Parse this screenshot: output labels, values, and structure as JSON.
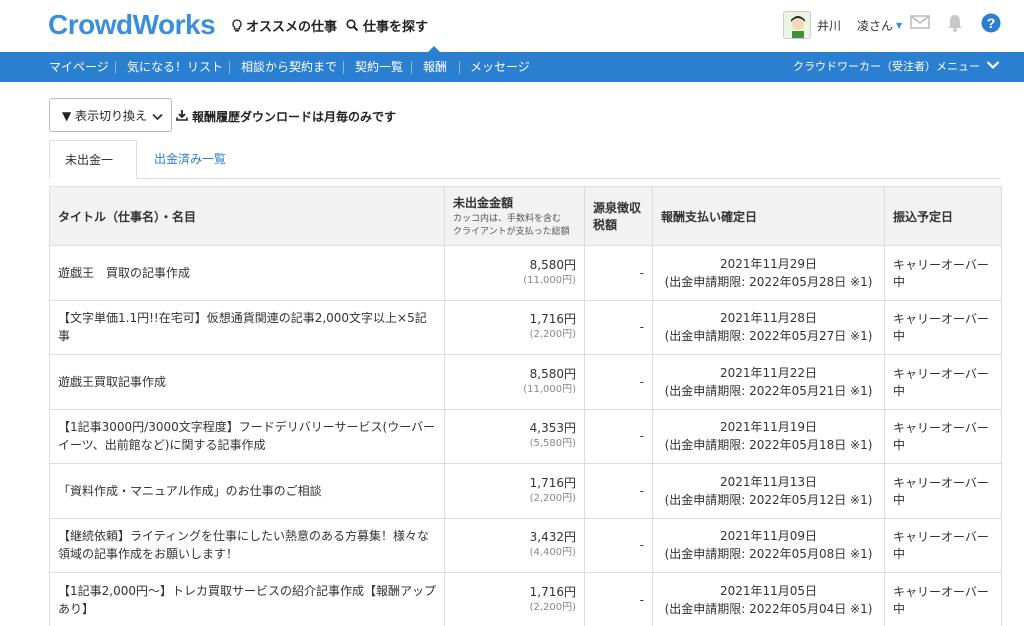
{
  "header": {
    "logo": "CrowdWorks",
    "recommend_jobs": "オススメの仕事",
    "find_jobs": "仕事を探す",
    "user_last": "井川",
    "user_first": "凌さん"
  },
  "nav": {
    "items": [
      "マイページ",
      "気になる！リスト",
      "相談から契約まで",
      "契約一覧",
      "報酬",
      "メッセージ"
    ],
    "active": "報酬",
    "right_menu": "クラウドワーカー（受注者）メニュー"
  },
  "controls": {
    "view_toggle": "▼ 表示切り換え",
    "download_note": "報酬履歴ダウンロードは月毎のみです"
  },
  "tabs": {
    "unpaid": "未出金一覧",
    "paid": "出金済み一覧"
  },
  "table": {
    "headers": {
      "title": "タイトル（仕事名）・名目",
      "amount": "未出金金額",
      "amount_note1": "カッコ内は、手数料を含む",
      "amount_note2": "クライアントが支払った総額",
      "tax1": "源泉徴収",
      "tax2": "税額",
      "confirm_date": "報酬支払い確定日",
      "transfer": "振込予定日"
    },
    "rows": [
      {
        "title": "遊戯王　買取の記事作成",
        "amount": "8,580円",
        "total": "(11,000円)",
        "tax": "-",
        "date": "2021年11月29日",
        "deadline": "(出金申請期限: 2022年05月28日 ※1)",
        "transfer": "キャリーオーバー中"
      },
      {
        "title": "【文字単価1.1円!!在宅可】仮想通貨関連の記事2,000文字以上×5記事",
        "amount": "1,716円",
        "total": "(2,200円)",
        "tax": "-",
        "date": "2021年11月28日",
        "deadline": "(出金申請期限: 2022年05月27日 ※1)",
        "transfer": "キャリーオーバー中"
      },
      {
        "title": "遊戯王買取記事作成",
        "amount": "8,580円",
        "total": "(11,000円)",
        "tax": "-",
        "date": "2021年11月22日",
        "deadline": "(出金申請期限: 2022年05月21日 ※1)",
        "transfer": "キャリーオーバー中"
      },
      {
        "title": "【1記事3000円/3000文字程度】フードデリバリーサービス(ウーバーイーツ、出前館など)に関する記事作成",
        "amount": "4,353円",
        "total": "(5,580円)",
        "tax": "-",
        "date": "2021年11月19日",
        "deadline": "(出金申請期限: 2022年05月18日 ※1)",
        "transfer": "キャリーオーバー中"
      },
      {
        "title": "「資料作成・マニュアル作成」のお仕事のご相談",
        "amount": "1,716円",
        "total": "(2,200円)",
        "tax": "-",
        "date": "2021年11月13日",
        "deadline": "(出金申請期限: 2022年05月12日 ※1)",
        "transfer": "キャリーオーバー中"
      },
      {
        "title": "【継続依頼】ライティングを仕事にしたい熱意のある方募集！様々な領域の記事作成をお願いします！",
        "amount": "3,432円",
        "total": "(4,400円)",
        "tax": "-",
        "date": "2021年11月09日",
        "deadline": "(出金申請期限: 2022年05月08日 ※1)",
        "transfer": "キャリーオーバー中"
      },
      {
        "title": "【1記事2,000円〜】トレカ買取サービスの紹介記事作成【報酬アップあり】",
        "amount": "1,716円",
        "total": "(2,200円)",
        "tax": "-",
        "date": "2021年11月05日",
        "deadline": "(出金申請期限: 2022年05月04日 ※1)",
        "transfer": "キャリーオーバー中"
      }
    ]
  },
  "colors": {
    "brand": "#2b7fd1",
    "logo": "#3a8fd8",
    "header_bg": "#f2f2f2"
  }
}
